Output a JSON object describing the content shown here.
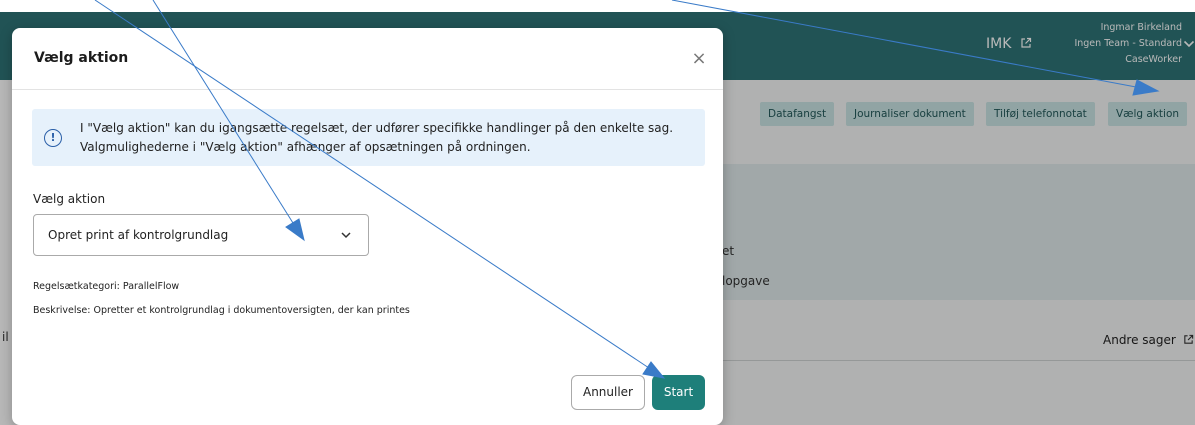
{
  "header": {
    "imk_label": "IMK",
    "user_name": "Ingmar Birkeland",
    "team": "Ingen Team - Standard",
    "role": "CaseWorker"
  },
  "toolbar": {
    "buttons": [
      "Datafangst",
      "Journaliser dokument",
      "Tilføj telefonnotat",
      "Vælg aktion"
    ]
  },
  "background": {
    "text_1": "et",
    "text_2": "lopgave",
    "text_3": "il",
    "other_cases_link": "Andre sager"
  },
  "modal": {
    "title": "Vælg aktion",
    "close_glyph": "×",
    "alert_icon": "!",
    "alert_text": "I \"Vælg aktion\" kan du igangsætte regelsæt, der udfører specifikke handlinger på den enkelte sag. Valgmulighederne i \"Vælg aktion\" afhænger af opsætningen på ordningen.",
    "field_label": "Vælg aktion",
    "select_value": "Opret print af kontrolgrundlag",
    "category_label": "Regelsætkategori:",
    "category_value": "ParallelFlow",
    "description_label": "Beskrivelse:",
    "description_value": "Opretter et kontrolgrundlag i dokumentoversigten, der kan printes",
    "cancel_label": "Annuller",
    "start_label": "Start"
  },
  "icons": {
    "external_link": "external-link-icon",
    "chevron": "chevron-down-icon",
    "info": "info-icon",
    "close": "close-icon"
  },
  "colors": {
    "header_teal": "#2e7476",
    "primary_button": "#1e7f7a",
    "alert_bg": "#e6f1fb",
    "annotation_arrow": "#3a7bc8"
  }
}
